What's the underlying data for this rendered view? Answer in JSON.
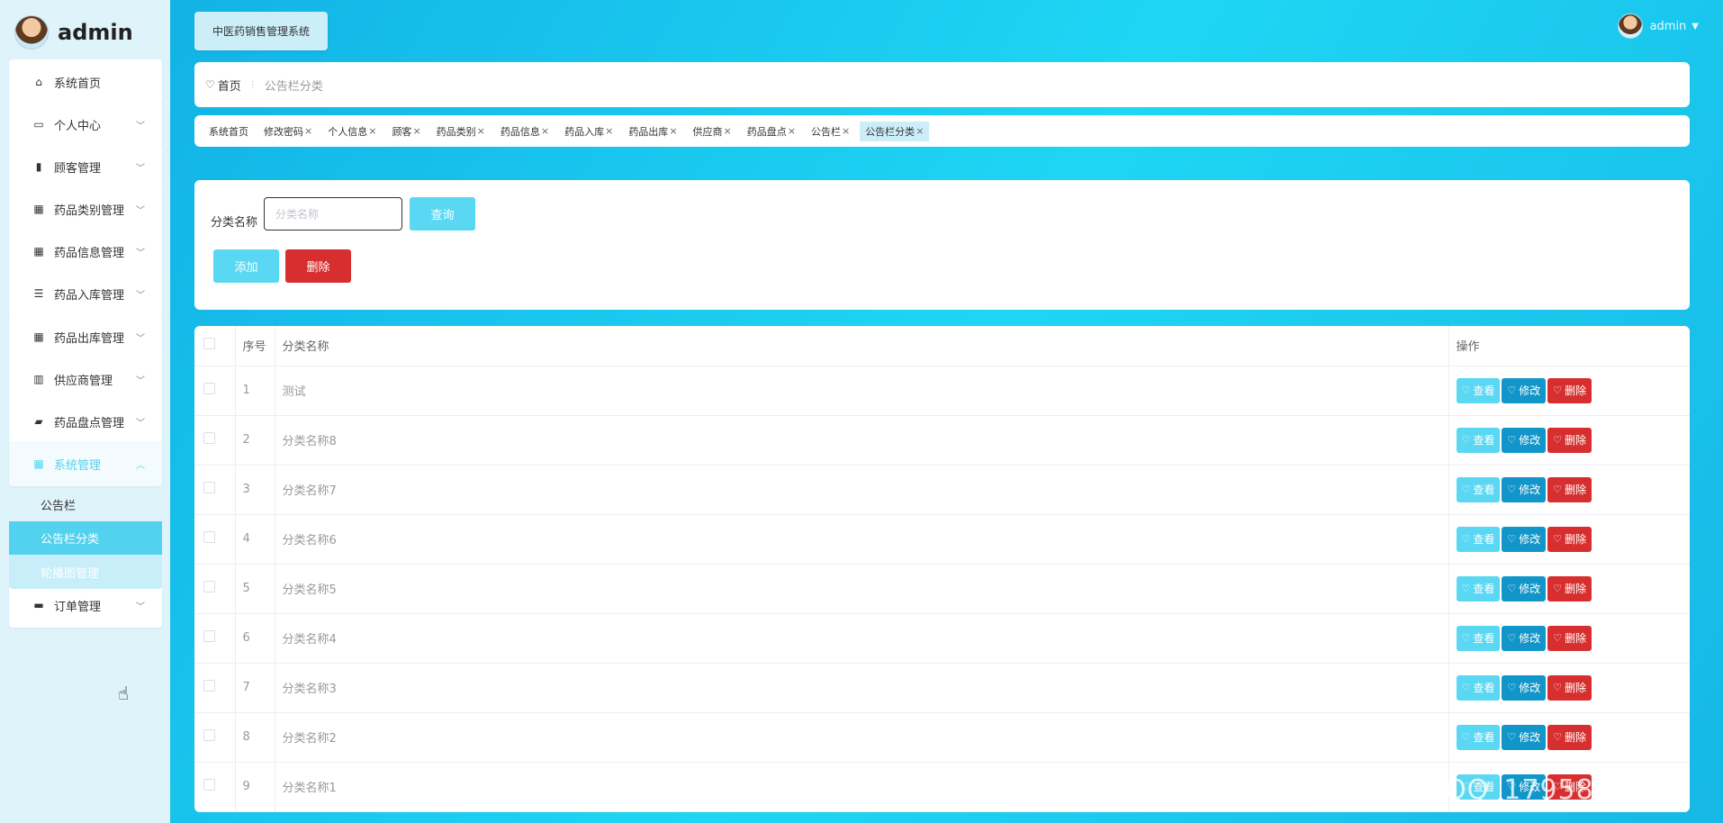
{
  "brand": {
    "name": "admin"
  },
  "sidebar": {
    "items": [
      {
        "label": "系统首页",
        "icon": "home-icon",
        "glyph": "⌂",
        "chevron": false
      },
      {
        "label": "个人中心",
        "icon": "card-icon",
        "glyph": "▭",
        "chevron": true
      },
      {
        "label": "顾客管理",
        "icon": "bar-chart-icon",
        "glyph": "▮",
        "chevron": true
      },
      {
        "label": "药品类别管理",
        "icon": "grid-icon",
        "glyph": "▦",
        "chevron": true
      },
      {
        "label": "药品信息管理",
        "icon": "grid-icon",
        "glyph": "▦",
        "chevron": true
      },
      {
        "label": "药品入库管理",
        "icon": "list-icon",
        "glyph": "☰",
        "chevron": true
      },
      {
        "label": "药品出库管理",
        "icon": "grid-icon",
        "glyph": "▦",
        "chevron": true
      },
      {
        "label": "供应商管理",
        "icon": "books-icon",
        "glyph": "▥",
        "chevron": true
      },
      {
        "label": "药品盘点管理",
        "icon": "wallet-icon",
        "glyph": "▰",
        "chevron": true
      },
      {
        "label": "系统管理",
        "icon": "grid-icon",
        "glyph": "▦",
        "chevron": true,
        "active": true
      },
      {
        "label": "订单管理",
        "icon": "briefcase-icon",
        "glyph": "▬",
        "chevron": true
      }
    ],
    "submenu": [
      {
        "label": "公告栏"
      },
      {
        "label": "公告栏分类",
        "selected": true
      },
      {
        "label": "轮播图管理",
        "hover": true
      }
    ]
  },
  "header": {
    "title": "中医药销售管理系统",
    "user": "admin"
  },
  "breadcrumb": {
    "home": "首页",
    "current": "公告栏分类"
  },
  "tags": [
    {
      "label": "系统首页",
      "closable": false
    },
    {
      "label": "修改密码",
      "closable": true
    },
    {
      "label": "个人信息",
      "closable": true
    },
    {
      "label": "顾客",
      "closable": true
    },
    {
      "label": "药品类别",
      "closable": true
    },
    {
      "label": "药品信息",
      "closable": true
    },
    {
      "label": "药品入库",
      "closable": true
    },
    {
      "label": "药品出库",
      "closable": true
    },
    {
      "label": "供应商",
      "closable": true
    },
    {
      "label": "药品盘点",
      "closable": true
    },
    {
      "label": "公告栏",
      "closable": true
    },
    {
      "label": "公告栏分类",
      "closable": true,
      "active": true
    }
  ],
  "search": {
    "label": "分类名称",
    "placeholder": "分类名称",
    "search_button": "查询",
    "add_button": "添加",
    "delete_button": "删除"
  },
  "table": {
    "columns": [
      "序号",
      "分类名称",
      "操作"
    ],
    "rows": [
      {
        "index": "1",
        "name": "测试"
      },
      {
        "index": "2",
        "name": "分类名称8"
      },
      {
        "index": "3",
        "name": "分类名称7"
      },
      {
        "index": "4",
        "name": "分类名称6"
      },
      {
        "index": "5",
        "name": "分类名称5"
      },
      {
        "index": "6",
        "name": "分类名称4"
      },
      {
        "index": "7",
        "name": "分类名称3"
      },
      {
        "index": "8",
        "name": "分类名称2"
      },
      {
        "index": "9",
        "name": "分类名称1"
      }
    ],
    "actions": {
      "view": "查看",
      "edit": "修改",
      "delete": "删除"
    }
  },
  "watermark": "CSDN @QQ_1795806396",
  "colors": {
    "accent": "#52d2ef",
    "primary_dark": "#1296c9",
    "danger": "#d72f2f"
  }
}
